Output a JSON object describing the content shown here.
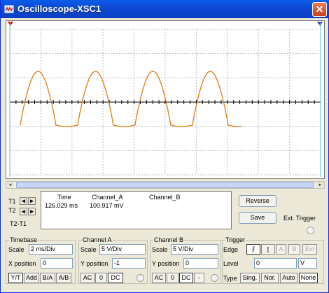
{
  "window": {
    "title": "Oscilloscope-XSC1",
    "close_glyph": "✕"
  },
  "colors": {
    "trace": "#e07b10",
    "grid": "#bbbbbb",
    "cursor_t1": "#d00000",
    "cursor_t2": "#2020c0",
    "cursor_line": "#40d0e0",
    "screen_bg": "#ffffff"
  },
  "icons": {
    "app": "oscilloscope-icon",
    "left": "arrow-left-icon",
    "right": "arrow-right-icon"
  },
  "cursors": {
    "t1_label": "T1",
    "t2_label": "T2",
    "diff_label": "T2-T1",
    "t1_marker": "1",
    "t2_marker": "2"
  },
  "readout": {
    "headers": {
      "time": "Time",
      "channel_a": "Channel_A",
      "channel_b": "Channel_B"
    },
    "t1": {
      "time": "126.029 ms",
      "channel_a": "100.917 mV",
      "channel_b": ""
    }
  },
  "buttons": {
    "reverse": "Reverse",
    "save": "Save",
    "ext_trigger": "Ext. Trigger"
  },
  "timebase": {
    "title": "Timebase",
    "scale_label": "Scale",
    "scale_value": "2 ms/Div",
    "xpos_label": "X position",
    "xpos_value": "0",
    "modes": [
      "Y/T",
      "Add",
      "B/A",
      "A/B"
    ]
  },
  "channel_a": {
    "title": "Channel A",
    "scale_label": "Scale",
    "scale_value": "5  V/Div",
    "ypos_label": "Y position",
    "ypos_value": "-1",
    "coupling": [
      "AC",
      "0",
      "DC"
    ]
  },
  "channel_b": {
    "title": "Channel B",
    "scale_label": "Scale",
    "scale_value": "5  V/Div",
    "ypos_label": "Y position",
    "ypos_value": "0",
    "coupling": [
      "AC",
      "0",
      "DC",
      "-"
    ]
  },
  "trigger": {
    "title": "Trigger",
    "edge_label": "Edge",
    "edge_rise": "⨍",
    "edge_fall": "ʈ",
    "source_a": "A",
    "source_b": "B",
    "source_ext": "Ext",
    "level_label": "Level",
    "level_value": "0",
    "level_unit": "V",
    "type_label": "Type",
    "types": [
      "Sing.",
      "Nor.",
      "Auto",
      "None"
    ]
  },
  "scrollbar": {
    "left": "◂",
    "right": "▸"
  }
}
